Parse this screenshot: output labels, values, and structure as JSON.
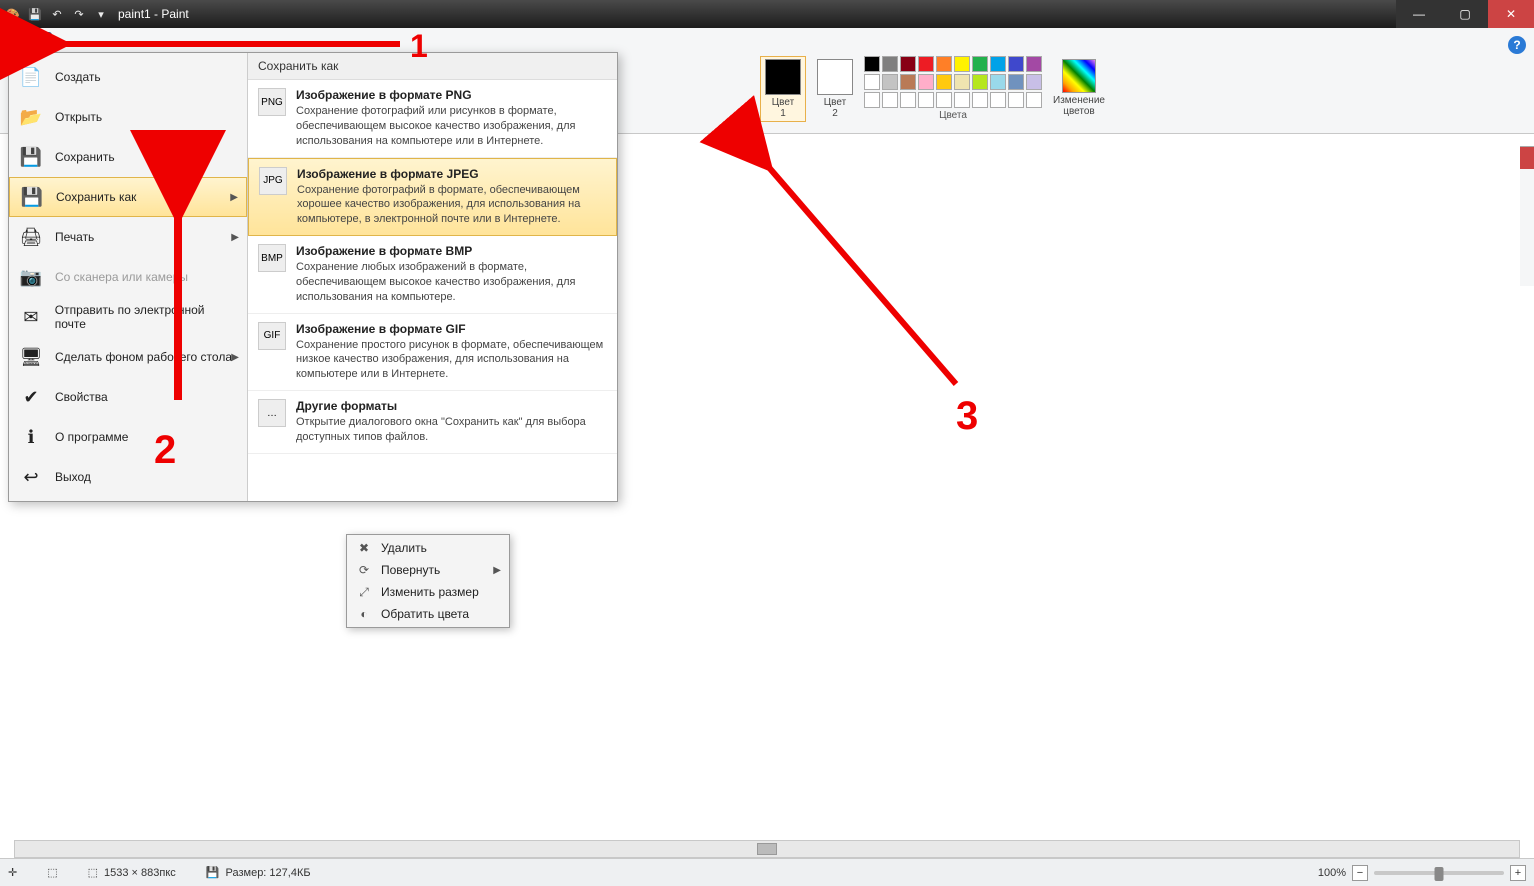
{
  "title": "paint1 - Paint",
  "file_button_icon": "▤▾",
  "ribbon": {
    "color1_label": "Цвет\n1",
    "color2_label": "Цвет\n2",
    "colors_group_label": "Цвета",
    "edit_colors_label": "Изменение\nцветов",
    "palette_row1": [
      "#000000",
      "#7f7f7f",
      "#880015",
      "#ed1c24",
      "#ff7f27",
      "#fff200",
      "#22b14c",
      "#00a2e8",
      "#3f48cc",
      "#a349a4"
    ],
    "palette_row2": [
      "#ffffff",
      "#c3c3c3",
      "#b97a57",
      "#ffaec9",
      "#ffc90e",
      "#efe4b0",
      "#b5e61d",
      "#99d9ea",
      "#7092be",
      "#c8bfe7"
    ],
    "palette_row3_empty": 10
  },
  "filemenu": {
    "items": [
      {
        "label": "Создать",
        "icon": "📄"
      },
      {
        "label": "Открыть",
        "icon": "📂"
      },
      {
        "label": "Сохранить",
        "icon": "💾"
      },
      {
        "label": "Сохранить как",
        "icon": "💾",
        "selected": true,
        "arrow": true,
        "underline": "к"
      },
      {
        "label": "Печать",
        "icon": "🖨",
        "arrow": true
      },
      {
        "label": "Со сканера или камеры",
        "icon": "📷",
        "disabled": true
      },
      {
        "label": "Отправить по электронной почте",
        "icon": "✉"
      },
      {
        "label": "Сделать фоном рабочего стола",
        "icon": "🖥",
        "arrow": true
      },
      {
        "label": "Свойства",
        "icon": "✔"
      },
      {
        "label": "О программе",
        "icon": "ℹ"
      },
      {
        "label": "Выход",
        "icon": "↩"
      }
    ],
    "submenu_header": "Сохранить как",
    "formats": [
      {
        "title": "Изображение в формате PNG",
        "desc": "Сохранение фотографий или рисунков в формате, обеспечивающем высокое качество изображения, для использования на компьютере или в Интернете.",
        "icon": "PNG"
      },
      {
        "title": "Изображение в формате JPEG",
        "desc": "Сохранение фотографий в формате, обеспечивающем хорошее качество изображения, для использования на компьютере, в электронной почте или в Интернете.",
        "icon": "JPG",
        "highlight": true
      },
      {
        "title": "Изображение в формате BMP",
        "desc": "Сохранение любых изображений в формате, обеспечивающем высокое качество изображения, для использования на компьютере.",
        "icon": "BMP"
      },
      {
        "title": "Изображение в формате GIF",
        "desc": "Сохранение простого рисунок в формате, обеспечивающем низкое качество изображения, для использования на компьютере или в Интернете.",
        "icon": "GIF"
      },
      {
        "title": "Другие форматы",
        "desc": "Открытие диалогового окна \"Сохранить как\" для выбора доступных типов файлов.",
        "icon": "…"
      }
    ]
  },
  "context_menu": {
    "items": [
      {
        "label": "Удалить",
        "icon": "✖"
      },
      {
        "label": "Повернуть",
        "icon": "⟳",
        "arrow": true
      },
      {
        "label": "Изменить размер",
        "icon": "⤢"
      },
      {
        "label": "Обратить цвета",
        "icon": "◐"
      }
    ]
  },
  "statusbar": {
    "cursor_icon": "✛",
    "selection_icon": "⬚",
    "dims_icon": "⬚",
    "dims": "1533 × 883пкс",
    "size_icon": "💾",
    "size_label": "Размер: 127,4КБ",
    "zoom": "100%"
  },
  "annotations": {
    "n1": "1",
    "n2": "2",
    "n3": "3"
  }
}
